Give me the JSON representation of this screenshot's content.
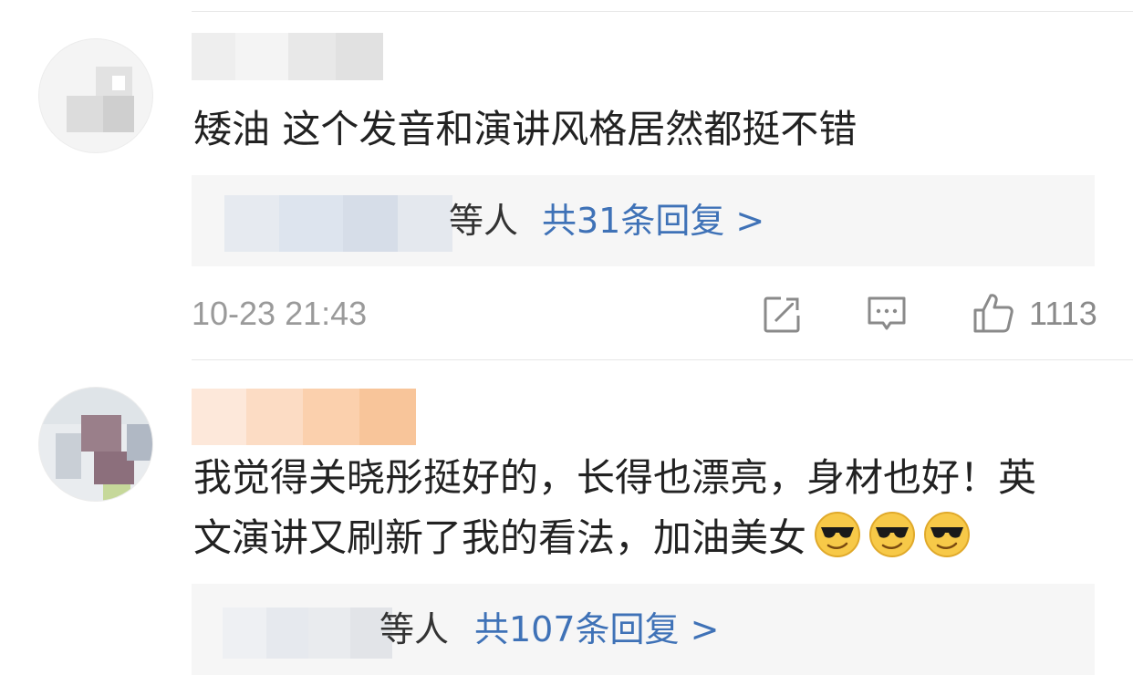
{
  "comments": [
    {
      "text": "矮油 这个发音和演讲风格居然都挺不错",
      "reply_suffix": "等人",
      "reply_link": "共31条回复 >",
      "timestamp": "10-23 21:43",
      "likes": "1113"
    },
    {
      "text_line1": "我觉得关晓彤挺好的，长得也漂亮，身材也好！英",
      "text_line2": "文演讲又刷新了我的看法，加油美女",
      "reply_suffix": "等人",
      "reply_link": "共107条回复 >"
    }
  ],
  "icons": {
    "share": "share-icon",
    "comment": "comment-icon",
    "like": "thumbs-up-icon",
    "emoji": "cool-sunglasses-emoji-icon"
  },
  "colors": {
    "link": "#3f72b7",
    "text": "#222222",
    "meta": "#9a9a9a",
    "reply_bg": "#f6f6f6"
  }
}
